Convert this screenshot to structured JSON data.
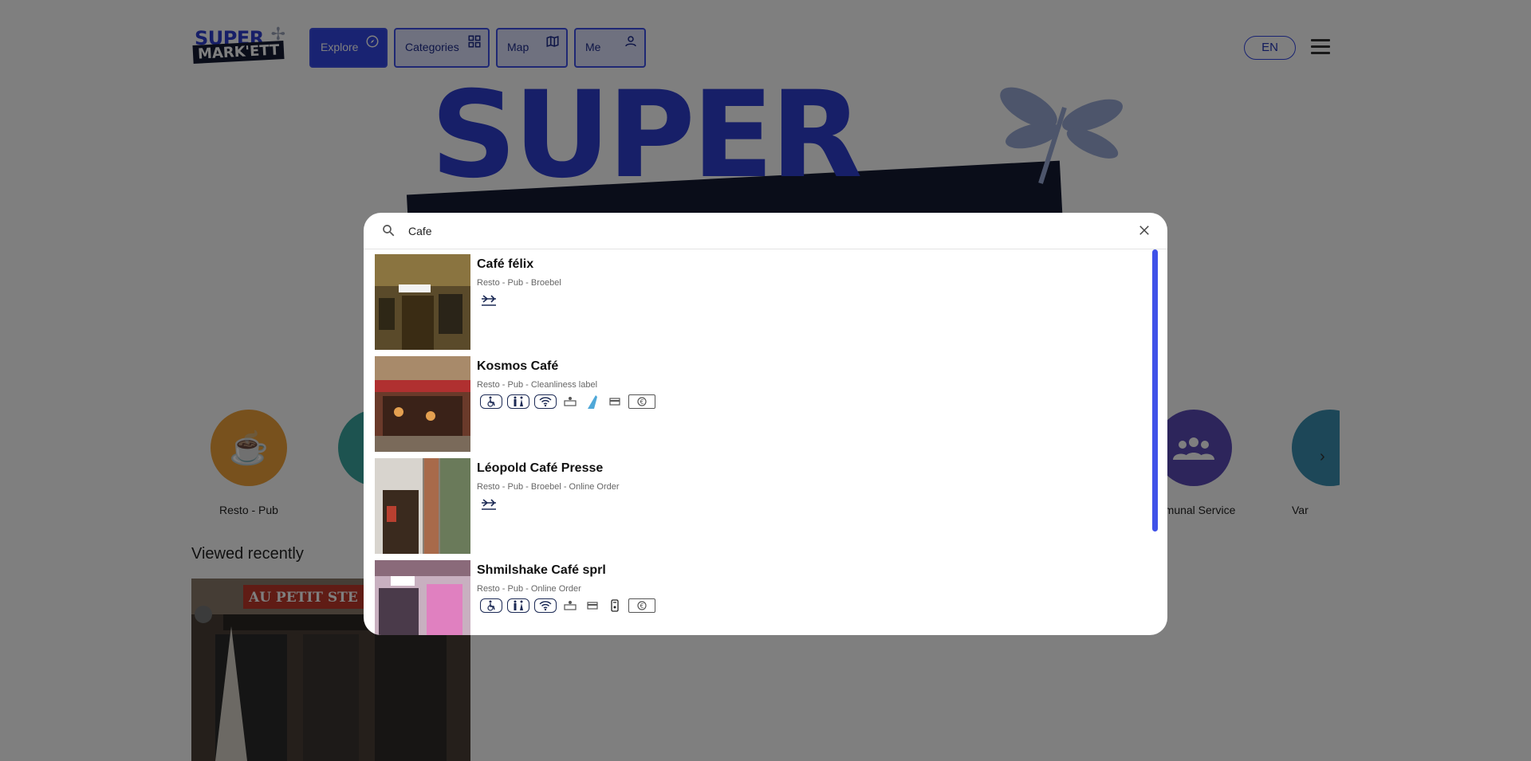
{
  "header": {
    "logo_line1": "SUPER",
    "logo_line2": "MARK'ETT",
    "nav": [
      {
        "label": "Explore",
        "icon": "compass-icon",
        "active": true
      },
      {
        "label": "Categories",
        "icon": "grid-icon",
        "active": false
      },
      {
        "label": "Map",
        "icon": "map-icon",
        "active": false
      },
      {
        "label": "Me",
        "icon": "person-icon",
        "active": false
      }
    ],
    "language": "EN"
  },
  "hero": {
    "text": "SUPER"
  },
  "categories": [
    {
      "label": "Resto - Pub",
      "color": "#f0a23a",
      "icon": "coffee-cup-icon"
    },
    {
      "label": "",
      "color": "#3aa6a0",
      "icon": "category-icon"
    },
    {
      "label": "mmunal Service",
      "color": "#5b4ab6",
      "icon": "people-icon"
    },
    {
      "label": "Var",
      "color": "#3a8fb0",
      "icon": "category-icon"
    }
  ],
  "viewed_recently": {
    "title": "Viewed recently",
    "card_sign": "AU PETIT STE"
  },
  "search": {
    "query": "Cafe",
    "placeholder": ""
  },
  "results": [
    {
      "name": "Café félix",
      "meta": "Resto - Pub - Broebel",
      "features": [
        "bicycle-icon"
      ]
    },
    {
      "name": "Kosmos Café",
      "meta": "Resto - Pub - Cleanliness label",
      "features": [
        "wheelchair-icon",
        "toilets-icon",
        "wifi-icon",
        "baby-change-icon",
        "dog-icon",
        "card-payment-icon",
        "euro-note-icon"
      ]
    },
    {
      "name": "Léopold Café Presse",
      "meta": "Resto - Pub - Broebel - Online Order",
      "features": [
        "bicycle-icon"
      ]
    },
    {
      "name": "Shmilshake Café sprl",
      "meta": "Resto - Pub - Online Order",
      "features": [
        "wheelchair-icon",
        "toilets-icon",
        "wifi-icon",
        "baby-change-icon",
        "card-payment-icon",
        "contactless-icon",
        "euro-note-icon"
      ]
    }
  ],
  "colors": {
    "accent": "#3347e4",
    "overlay": "rgba(0,0,0,0.5)"
  }
}
